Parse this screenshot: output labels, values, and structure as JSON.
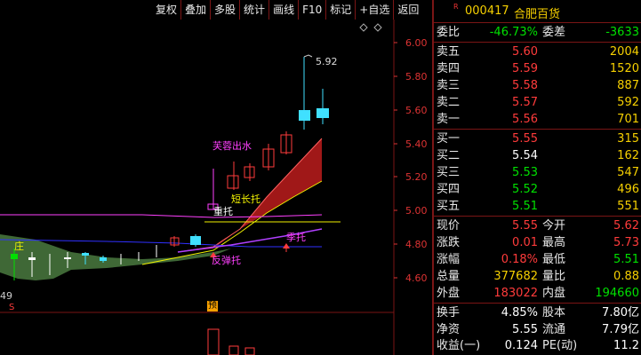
{
  "toolbar": {
    "items": [
      "复权",
      "叠加",
      "多股",
      "统计",
      "画线",
      "F10",
      "标记",
      "+自选",
      "返回"
    ]
  },
  "chart": {
    "price_axis": [
      "6.00",
      "5.80",
      "5.60",
      "5.40",
      "5.20",
      "5.00",
      "4.80",
      "4.60"
    ],
    "peak_label": "5.92",
    "left_edge_number": "49",
    "annotations": {
      "hibiscus": "芙蓉出水",
      "short_support": "短长托",
      "heavy_support": "重托",
      "ji_support": "季托",
      "rebound_support": "反弹托",
      "zhuang": "庄"
    },
    "markers": {
      "s_marker": "S",
      "yu_marker": "预"
    },
    "colors": {
      "up_candle": "#ff3b3b",
      "cyan_candle": "#40e0ff",
      "ribbon": "#a01818",
      "ribbon_fill_green": "#4a7a40",
      "line_yellow": "#f0f000",
      "line_magenta": "#ff40ff",
      "line_purple": "#b040ff"
    }
  },
  "quote": {
    "r_mark": "R",
    "code": "000417",
    "name": "合肥百货",
    "weibi_label": "委比",
    "weibi_value": "-46.73%",
    "weicha_label": "委差",
    "weicha_value": "-3633",
    "sells": [
      {
        "label": "卖五",
        "price": "5.60",
        "volume": "2004"
      },
      {
        "label": "卖四",
        "price": "5.59",
        "volume": "1520"
      },
      {
        "label": "卖三",
        "price": "5.58",
        "volume": "887"
      },
      {
        "label": "卖二",
        "price": "5.57",
        "volume": "592"
      },
      {
        "label": "卖一",
        "price": "5.56",
        "volume": "701"
      }
    ],
    "buys": [
      {
        "label": "买一",
        "price": "5.55",
        "volume": "315"
      },
      {
        "label": "买二",
        "price": "5.54",
        "volume": "162"
      },
      {
        "label": "买三",
        "price": "5.53",
        "volume": "547"
      },
      {
        "label": "买四",
        "price": "5.52",
        "volume": "496"
      },
      {
        "label": "买五",
        "price": "5.51",
        "volume": "551"
      }
    ],
    "stats": [
      {
        "l1": "现价",
        "v1": "5.55",
        "l2": "今开",
        "v2": "5.62"
      },
      {
        "l1": "涨跌",
        "v1": "0.01",
        "l2": "最高",
        "v2": "5.73"
      },
      {
        "l1": "涨幅",
        "v1": "0.18%",
        "l2": "最低",
        "v2": "5.51"
      },
      {
        "l1": "总量",
        "v1": "377682",
        "l2": "量比",
        "v2": "0.88"
      },
      {
        "l1": "外盘",
        "v1": "183022",
        "l2": "内盘",
        "v2": "194660"
      }
    ],
    "stats2": [
      {
        "l1": "换手",
        "v1": "4.85%",
        "l2": "股本",
        "v2": "7.80亿"
      },
      {
        "l1": "净资",
        "v1": "5.55",
        "l2": "流通",
        "v2": "7.79亿"
      },
      {
        "l1": "收益(一)",
        "v1": "0.124",
        "l2": "PE(动)",
        "v2": "11.2"
      }
    ]
  }
}
